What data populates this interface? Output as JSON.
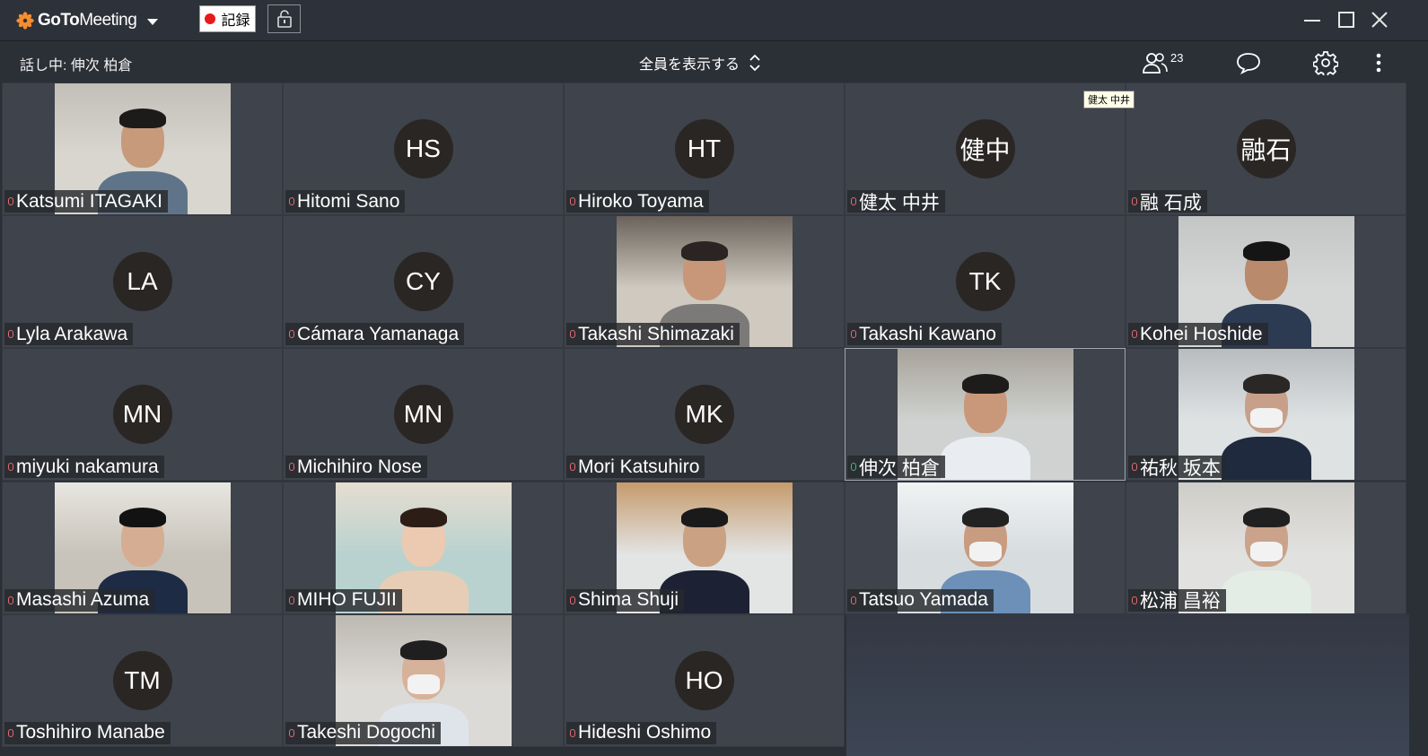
{
  "app": {
    "name_bold": "GoTo",
    "name_regular": "Meeting",
    "record_label": "記録",
    "record_color": "#e8191b",
    "accent_color": "#f68d2e"
  },
  "toolbar": {
    "speaking_label": "話し中: 伸次 柏倉",
    "view_selector": "全員を表示する",
    "participant_count": "23",
    "icons": [
      "attendees-icon",
      "chat-icon",
      "settings-icon",
      "more-icon"
    ]
  },
  "tooltip": "健太 中井",
  "participants": [
    {
      "name": "Katsumi ITAGAKI",
      "video": true,
      "mic": "muted"
    },
    {
      "name": "Hitomi Sano",
      "initials": "HS",
      "mic": "muted"
    },
    {
      "name": "Hiroko Toyama",
      "initials": "HT",
      "mic": "muted"
    },
    {
      "name": "健太 中井",
      "initials": "健中",
      "mic": "muted"
    },
    {
      "name": "融 石成",
      "initials": "融石",
      "mic": "muted"
    },
    {
      "name": "Lyla Arakawa",
      "initials": "LA",
      "mic": "muted"
    },
    {
      "name": "Cámara Yamanaga",
      "initials": "CY",
      "mic": "muted"
    },
    {
      "name": "Takashi Shimazaki",
      "video": true,
      "mic": "muted"
    },
    {
      "name": "Takashi Kawano",
      "initials": "TK",
      "mic": "muted"
    },
    {
      "name": "Kohei Hoshide",
      "video": true,
      "mic": "muted"
    },
    {
      "name": "miyuki nakamura",
      "initials": "MN",
      "mic": "muted"
    },
    {
      "name": "Michihiro Nose",
      "initials": "MN",
      "mic": "muted"
    },
    {
      "name": "Mori Katsuhiro",
      "initials": "MK",
      "mic": "muted"
    },
    {
      "name": "伸次 柏倉",
      "video": true,
      "mic": "active",
      "speaking": true
    },
    {
      "name": "祐秋 坂本",
      "video": true,
      "mic": "muted"
    },
    {
      "name": "Masashi Azuma",
      "video": true,
      "mic": "muted"
    },
    {
      "name": "MIHO FUJII",
      "video": true,
      "mic": "muted"
    },
    {
      "name": "Shima Shuji",
      "video": true,
      "mic": "muted"
    },
    {
      "name": "Tatsuo Yamada",
      "video": true,
      "mic": "muted"
    },
    {
      "name": "松浦 昌裕",
      "video": true,
      "mic": "muted"
    },
    {
      "name": "Toshihiro Manabe",
      "initials": "TM",
      "mic": "muted"
    },
    {
      "name": "Takeshi Dogochi",
      "video": true,
      "mic": "muted"
    },
    {
      "name": "Hideshi Oshimo",
      "initials": "HO",
      "mic": "muted"
    }
  ]
}
